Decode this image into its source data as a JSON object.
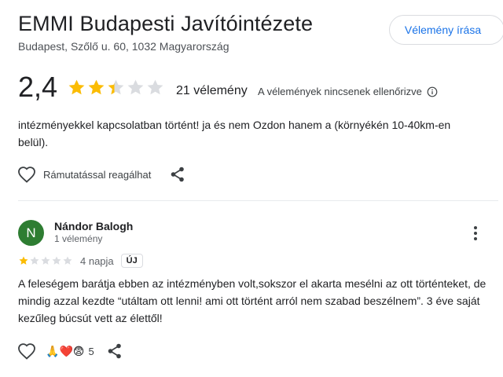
{
  "place": {
    "title": "EMMI Budapesti Javítóintézete",
    "address": "Budapest, Szőlő u. 60, 1032 Magyarország",
    "write_review_label": "Vélemény írása"
  },
  "summary": {
    "rating": "2,4",
    "stars": 2.4,
    "review_count": "21 vélemény",
    "not_verified": "A vélemények nincsenek ellenőrizve"
  },
  "previous_review": {
    "text": "intézményekkel kapcsolatban történt! ja és nem Ozdon hanem a (környékén 10-40km-en belül).",
    "react_label": "Rámutatással reagálhat"
  },
  "review": {
    "avatar_letter": "N",
    "avatar_color": "#2e7d32",
    "name": "Nándor Balogh",
    "meta": "1 vélemény",
    "stars": 1,
    "date": "4 napja",
    "badge": "ÚJ",
    "text": "A feleségem barátja ebben az intézményben volt,sokszor el akarta mesélni az ott történteket, de mindig azzal kezdte “utáltam ott lenni! ami ott történt arról nem szabad beszélnem”. 3 éve saját kezűleg búcsút vett az élettől!",
    "reactions": [
      "🙏",
      "❤️",
      "😨"
    ],
    "reaction_count": "5"
  },
  "colors": {
    "star_filled": "#fbbc04",
    "star_empty": "#dadce0",
    "link_blue": "#1a73e8"
  }
}
